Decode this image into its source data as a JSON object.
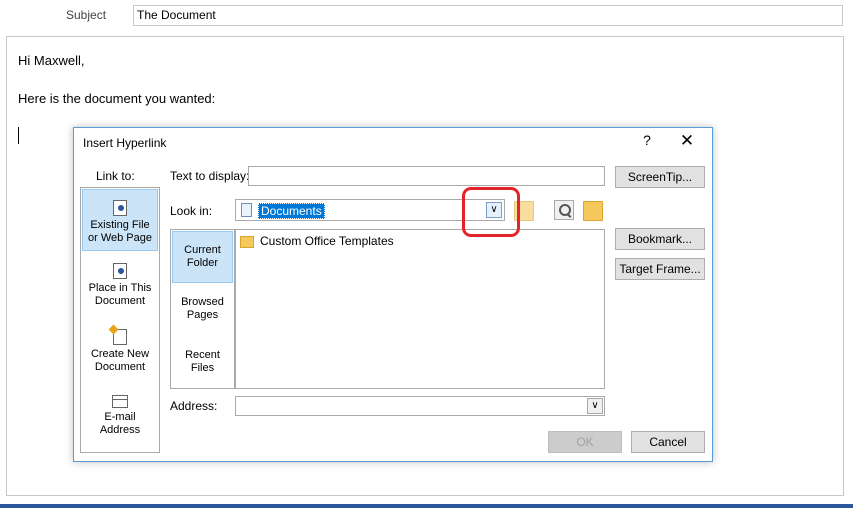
{
  "email": {
    "subject_label": "Subject",
    "subject_value": "The Document",
    "body_lines": [
      "Hi Maxwell,",
      "Here is the document you wanted:"
    ]
  },
  "dialog": {
    "title": "Insert Hyperlink",
    "help": "?",
    "close": "✕",
    "link_to_label": "Link to:",
    "link_options": [
      {
        "line1": "Existing File",
        "line2": "or Web Page",
        "icon": "web-page-icon"
      },
      {
        "line1": "Place in This",
        "line2": "Document",
        "icon": "place-in-document-icon"
      },
      {
        "line1": "Create New",
        "line2": "Document",
        "icon": "new-document-icon"
      },
      {
        "line1": "E-mail",
        "line2": "Address",
        "icon": "email-icon"
      }
    ],
    "text_to_display_label": "Text to display:",
    "text_to_display_value": "",
    "screentip_button": "ScreenTip...",
    "look_in_label": "Look in:",
    "look_in_value": "Documents",
    "nav_items": [
      {
        "line1": "Current",
        "line2": "Folder"
      },
      {
        "line1": "Browsed",
        "line2": "Pages"
      },
      {
        "line1": "Recent",
        "line2": "Files"
      }
    ],
    "files": [
      "Custom Office Templates"
    ],
    "bookmark_button": "Bookmark...",
    "target_frame_button": "Target Frame...",
    "address_label": "Address:",
    "address_value": "",
    "ok_button": "OK",
    "cancel_button": "Cancel"
  },
  "colors": {
    "accent": "#0078d7",
    "selection": "#cce4f7",
    "highlight_annotation": "#e3242b",
    "taskbar": "#2b579a"
  }
}
